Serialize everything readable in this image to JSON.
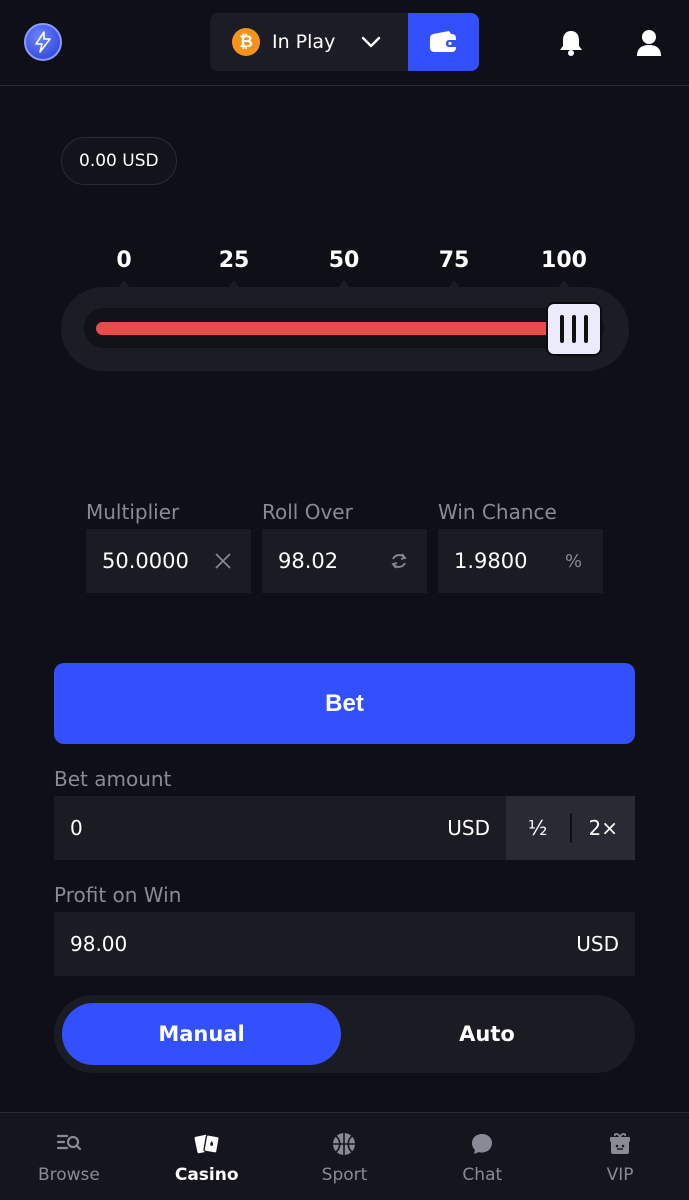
{
  "header": {
    "currency_label": "In Play",
    "currency_icon": "bitcoin-icon",
    "accent": "#3350ff"
  },
  "balance": {
    "text": "0.00 USD"
  },
  "slider": {
    "ticks": [
      "0",
      "25",
      "50",
      "75",
      "100"
    ],
    "value": 98.02,
    "min": 0,
    "max": 100,
    "lose_color": "#e84c4c",
    "win_color": "#3fcf5a"
  },
  "stats": {
    "multiplier": {
      "label": "Multiplier",
      "value": "50.0000",
      "icon": "close-icon"
    },
    "roll_over": {
      "label": "Roll Over",
      "value": "98.02",
      "icon": "refresh-icon"
    },
    "win_chance": {
      "label": "Win Chance",
      "value": "1.9800",
      "icon": "%"
    }
  },
  "bet_button": {
    "label": "Bet"
  },
  "bet_amount": {
    "label": "Bet amount",
    "value": "0",
    "unit": "USD",
    "half_label": "½",
    "double_label": "2×"
  },
  "profit": {
    "label": "Profit on Win",
    "value": "98.00",
    "unit": "USD"
  },
  "mode": {
    "manual": "Manual",
    "auto": "Auto",
    "selected": "Manual"
  },
  "nav": {
    "items": [
      {
        "label": "Browse",
        "icon": "browse-icon"
      },
      {
        "label": "Casino",
        "icon": "casino-icon",
        "active": true
      },
      {
        "label": "Sport",
        "icon": "sport-icon"
      },
      {
        "label": "Chat",
        "icon": "chat-icon"
      },
      {
        "label": "VIP",
        "icon": "vip-icon"
      }
    ]
  }
}
